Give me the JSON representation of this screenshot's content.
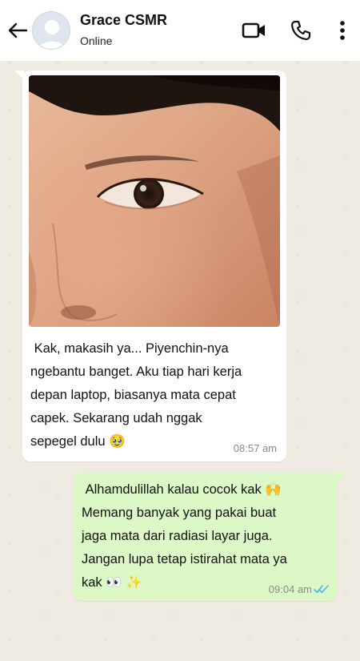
{
  "header": {
    "contact_name": "Grace CSMR",
    "status": "Online",
    "icons": [
      "back-arrow-icon",
      "video-call-icon",
      "phone-icon",
      "more-vert-icon"
    ]
  },
  "messages": [
    {
      "direction": "incoming",
      "has_image": true,
      "text": " Kak, makasih ya... Piyenchin-nya\nngebantu banget. Aku tiap hari kerja\ndepan laptop, biasanya mata cepat\ncapek. Sekarang udah nggak\nsepegel dulu 🥹",
      "time": "08:57 am"
    },
    {
      "direction": "outgoing",
      "text": " Alhamdulillah kalau cocok kak 🙌\nMemang banyak yang pakai buat\njaga mata dari radiasi layar juga.\nJangan lupa tetap istirahat mata ya\nkak 👀 ✨",
      "time": "09:04 am",
      "read": true
    }
  ],
  "colors": {
    "chat_background": "#efeae2",
    "incoming_bubble": "#ffffff",
    "outgoing_bubble": "#dcf8c6",
    "read_ticks": "#4fb6ec"
  }
}
